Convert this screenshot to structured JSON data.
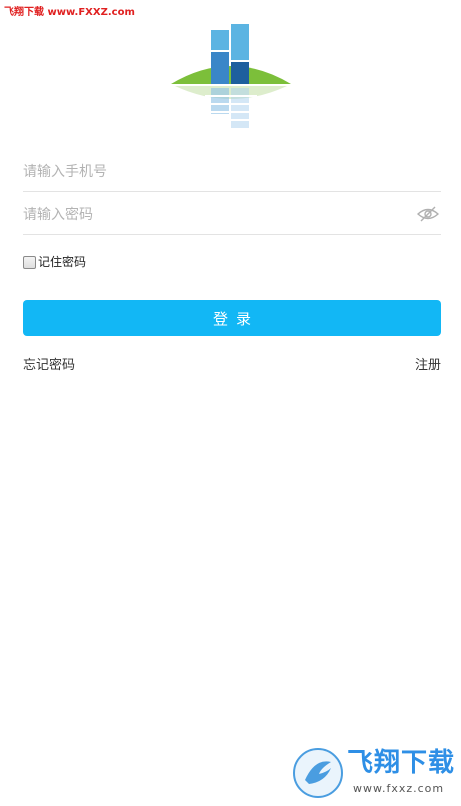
{
  "watermark_top": "飞翔下载 www.FXXZ.com",
  "login": {
    "phone_placeholder": "请输入手机号",
    "password_placeholder": "请输入密码",
    "remember_label": "记住密码",
    "submit_label": "登录",
    "forgot_label": "忘记密码",
    "register_label": "注册"
  },
  "watermark_bottom": {
    "title": "飞翔下载",
    "url": "www.fxxz.com"
  },
  "colors": {
    "primary": "#12b7f5",
    "divider": "#e3e3e3",
    "placeholder": "#b3b3b3",
    "logo_green": "#7cbf3a",
    "logo_blue": "#3a86c8"
  },
  "icons": {
    "logo": "building-logo-icon",
    "password_toggle": "eye-hidden-icon",
    "watermark": "fxxz-logo-icon"
  }
}
